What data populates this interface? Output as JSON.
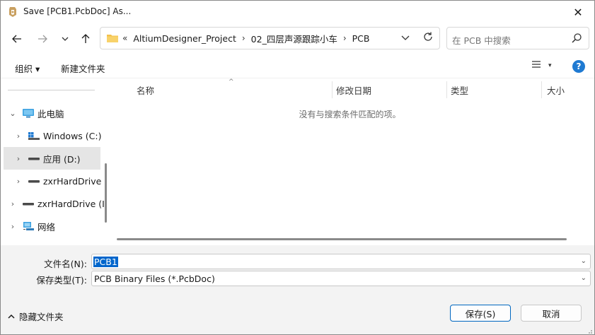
{
  "window": {
    "title": "Save [PCB1.PcbDoc] As...",
    "close_glyph": "✕"
  },
  "nav": {
    "back_icon": "arrow-left-icon",
    "forward_icon": "arrow-right-icon",
    "recent_icon": "chevron-down-icon",
    "up_icon": "arrow-up-icon"
  },
  "address": {
    "overflow": "«",
    "crumbs": [
      "AltiumDesigner_Project",
      "02_四层声源跟踪小车",
      "PCB"
    ]
  },
  "search": {
    "placeholder": "在 PCB 中搜索"
  },
  "commands": {
    "organize": "组织 ▾",
    "new_folder": "新建文件夹",
    "help": "?"
  },
  "tree": {
    "items": [
      {
        "label": "此电脑",
        "chevron": "⌄",
        "icon": "computer-icon"
      },
      {
        "label": "Windows (C:)",
        "chevron": "›",
        "icon": "windows-drive-icon"
      },
      {
        "label": "应用 (D:)",
        "chevron": "›",
        "icon": "drive-icon"
      },
      {
        "label": "zxrHardDrive",
        "chevron": "›",
        "icon": "drive-icon"
      },
      {
        "label": "zxrHardDrive (I",
        "chevron": "›",
        "icon": "drive-icon"
      },
      {
        "label": "网络",
        "chevron": "›",
        "icon": "network-icon"
      }
    ]
  },
  "list": {
    "columns": [
      "名称",
      "修改日期",
      "类型",
      "大小"
    ],
    "empty_message": "没有与搜索条件匹配的项。"
  },
  "form": {
    "filename_label": "文件名(N):",
    "filename_value": "PCB1",
    "filetype_label": "保存类型(T):",
    "filetype_value": "PCB Binary Files (*.PcbDoc)"
  },
  "footer": {
    "hide_folders": "隐藏文件夹",
    "save": "保存(S)",
    "cancel": "取消"
  },
  "colors": {
    "accent": "#0067c0",
    "selection": "#0066cc",
    "folder": "#f3c14b"
  }
}
